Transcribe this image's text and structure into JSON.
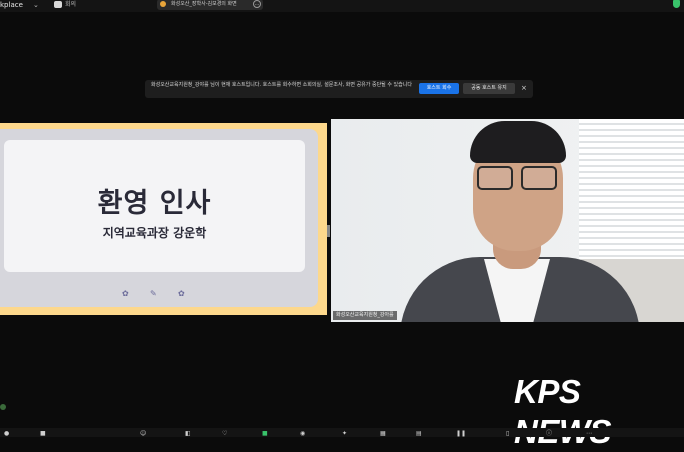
{
  "topbar": {
    "app_name": "kplace",
    "meeting_label": "회의",
    "share_label": "화성오산_장학사-김보경의 화면"
  },
  "notification": {
    "message": "화성오산교육지원청_강야를 님이 현재 호스트입니다. 호스트를 회수하면 소회의실, 설문조사, 화면 공유가 중단될 수 있습니다",
    "primary_button": "호스트 회수",
    "secondary_button": "공동 호스트 유지",
    "close": "×"
  },
  "slide": {
    "title": "환영 인사",
    "subtitle": "지역교육과장 강운학"
  },
  "video": {
    "participant_name": "화성오산교육지원청_강아를"
  },
  "watermark": "KPS NEWS",
  "colors": {
    "slide_frame": "#fdd88c",
    "primary_button": "#1a73e8",
    "background": "#0b0b0b"
  },
  "icons": {
    "slide_controls": [
      "gear-icon",
      "pencil-icon",
      "gear-icon"
    ]
  }
}
